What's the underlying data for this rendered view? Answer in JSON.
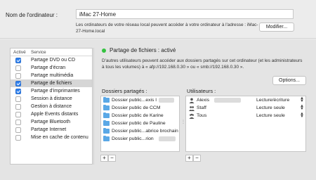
{
  "computer_name": {
    "label": "Nom de l'ordinateur :",
    "value": "iMac 27-Home",
    "hint": "Les ordinateurs de votre réseau local peuvent accéder à votre ordinateur à l'adresse : iMac-27-Home.local",
    "modify_button": "Modifier..."
  },
  "services": {
    "header_active": "Activé",
    "header_service": "Service",
    "items": [
      {
        "label": "Partage DVD ou CD",
        "checked": true
      },
      {
        "label": "Partage d'écran",
        "checked": false
      },
      {
        "label": "Partage multimédia",
        "checked": false
      },
      {
        "label": "Partage de fichiers",
        "checked": true
      },
      {
        "label": "Partage d'imprimantes",
        "checked": true
      },
      {
        "label": "Session à distance",
        "checked": false
      },
      {
        "label": "Gestion à distance",
        "checked": false
      },
      {
        "label": "Apple Events distants",
        "checked": false
      },
      {
        "label": "Partage Bluetooth",
        "checked": false
      },
      {
        "label": "Partage Internet",
        "checked": false
      },
      {
        "label": "Mise en cache de contenu",
        "checked": false
      }
    ]
  },
  "status": {
    "label": "Partage de fichiers : activé",
    "color": "#34c240",
    "description": "D'autres utilisateurs peuvent accéder aux dossiers partagés sur cet ordinateur (et les administrateurs à tous les volumes) à « afp://192.168.0.30 » ou « smb://192.168.0.30 ».",
    "options_button": "Options..."
  },
  "shared_folders": {
    "label": "Dossiers partagés :",
    "items": [
      "Dossier public...exis l",
      "Dossier public de CCM",
      "Dossier public de Karine",
      "Dossier public de Pauline",
      "Dossier public...abrice brochain",
      "Dossier public...rion"
    ]
  },
  "users": {
    "label": "Utilisateurs :",
    "items": [
      {
        "name": "Alexis",
        "permission": "Lecture/écriture",
        "icon": "person-icon"
      },
      {
        "name": "Staff",
        "permission": "Lecture seule",
        "icon": "group-icon"
      },
      {
        "name": "Tous",
        "permission": "Lecture seule",
        "icon": "everyone-icon"
      }
    ]
  },
  "buttons": {
    "add": "+",
    "remove": "−"
  }
}
